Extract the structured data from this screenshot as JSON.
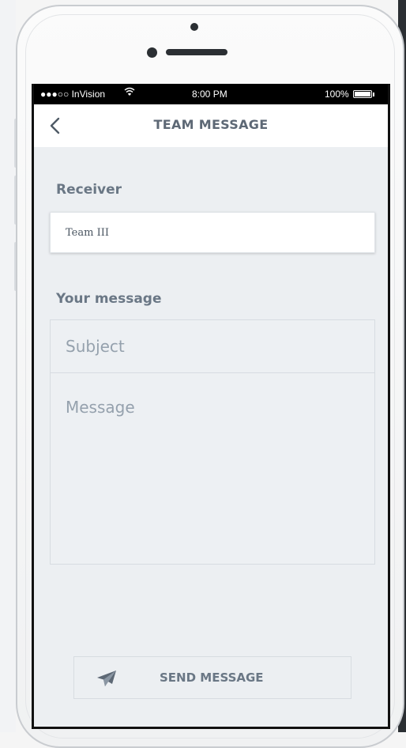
{
  "status_bar": {
    "carrier": "●●●○○ InVision",
    "time": "8:00 PM",
    "battery": "100%"
  },
  "nav": {
    "title": "TEAM MESSAGE"
  },
  "receiver": {
    "label": "Receiver",
    "value": "Team III"
  },
  "message": {
    "label": "Your message",
    "subject_placeholder": "Subject",
    "body_placeholder": "Message"
  },
  "send_button": {
    "label": "SEND MESSAGE"
  },
  "icons": {
    "back": "chevron-left-icon",
    "send": "paper-plane-icon",
    "wifi": "wifi-icon",
    "battery": "battery-icon"
  },
  "colors": {
    "screen_bg": "#eceff2",
    "title_text": "#5d6875",
    "label_text": "#6a7785",
    "placeholder_text": "#95a1ad"
  }
}
